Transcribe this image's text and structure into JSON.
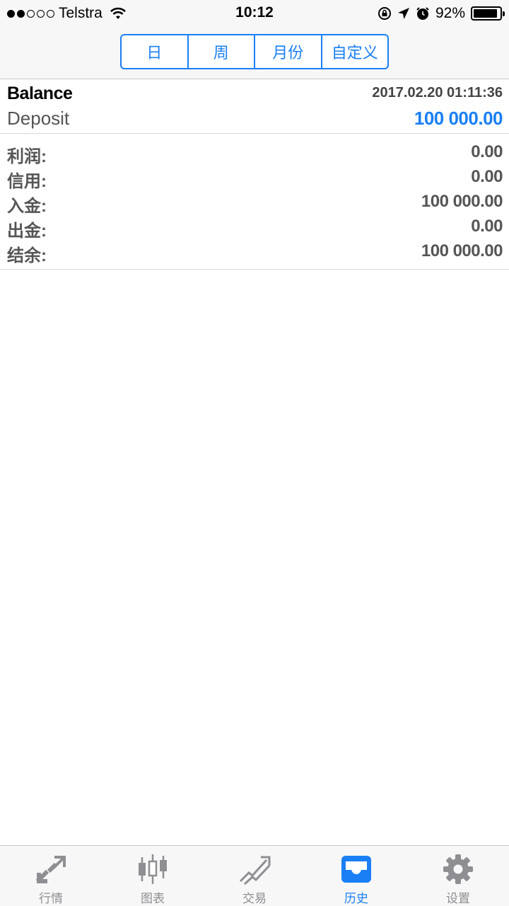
{
  "status_bar": {
    "carrier": "Telstra",
    "time": "10:12",
    "battery": "92%",
    "battery_level": 0.92
  },
  "segments": [
    {
      "label": "日",
      "active": true
    },
    {
      "label": "周",
      "active": false
    },
    {
      "label": "月份",
      "active": false
    },
    {
      "label": "自定义",
      "active": false
    }
  ],
  "record": {
    "type": "Balance",
    "datetime": "2017.02.20 01:11:36",
    "comment": "Deposit",
    "amount": "100 000.00"
  },
  "summary": [
    {
      "label": "利润:",
      "value": "0.00"
    },
    {
      "label": "信用:",
      "value": "0.00"
    },
    {
      "label": "入金:",
      "value": "100 000.00"
    },
    {
      "label": "出金:",
      "value": "0.00"
    },
    {
      "label": "结余:",
      "value": "100 000.00"
    }
  ],
  "tabs": [
    {
      "label": "行情",
      "icon": "quotes-arrows-icon",
      "active": false
    },
    {
      "label": "图表",
      "icon": "candlestick-chart-icon",
      "active": false
    },
    {
      "label": "交易",
      "icon": "trade-chart-icon",
      "active": false
    },
    {
      "label": "历史",
      "icon": "history-inbox-icon",
      "active": true
    },
    {
      "label": "设置",
      "icon": "gear-icon",
      "active": false
    }
  ],
  "colors": {
    "accent": "#1a7ff5",
    "tab_inactive": "#8e8e93"
  }
}
